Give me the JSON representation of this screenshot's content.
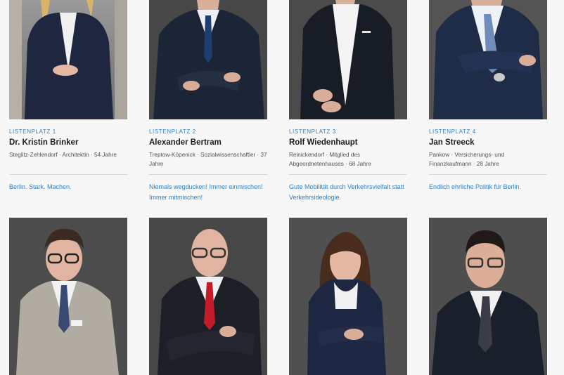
{
  "candidates": [
    {
      "rank": "LISTENPLATZ 1",
      "name": "Dr. Kristin Brinker",
      "meta": "Steglitz-Zehlendorf · Architektin · 54 Jahre",
      "slogan": "Berlin. Stark. Machen.",
      "photo": "portrait-woman-blonde-navy-blazer"
    },
    {
      "rank": "LISTENPLATZ 2",
      "name": "Alexander Bertram",
      "meta": "Treptow-Köpenick · Sozialwissenschaftler · 37 Jahre",
      "slogan": "Niemals wegducken! Immer einmischen! Immer mitmischen!",
      "photo": "portrait-man-navy-suit-blue-tie-arms-crossed"
    },
    {
      "rank": "LISTENPLATZ 3",
      "name": "Rolf Wiedenhaupt",
      "meta": "Reinickendorf · Mitglied des Abgeordnetenhauses · 68 Jahre",
      "slogan": "Gute Mobilität durch Verkehrsvielfalt statt Verkehrsideologie.",
      "photo": "portrait-man-dark-suit-white-shirt"
    },
    {
      "rank": "LISTENPLATZ 4",
      "name": "Jan Streeck",
      "meta": "Pankow · Versicherungs- und Finanzkaufmann · 28 Jahre",
      "slogan": "Endlich ehrliche Politik für Berlin.",
      "photo": "portrait-man-navy-suit-arms-crossed"
    },
    {
      "photo": "portrait-man-glasses-grey-jacket"
    },
    {
      "photo": "portrait-man-bald-glasses-red-tie"
    },
    {
      "photo": "portrait-woman-brown-hair-navy-cardigan"
    },
    {
      "photo": "portrait-man-glasses-dark-suit"
    }
  ],
  "colors": {
    "accent": "#2f7fc3",
    "name": "#1c1c1c",
    "meta": "#555555",
    "background": "#f7f7f7"
  }
}
